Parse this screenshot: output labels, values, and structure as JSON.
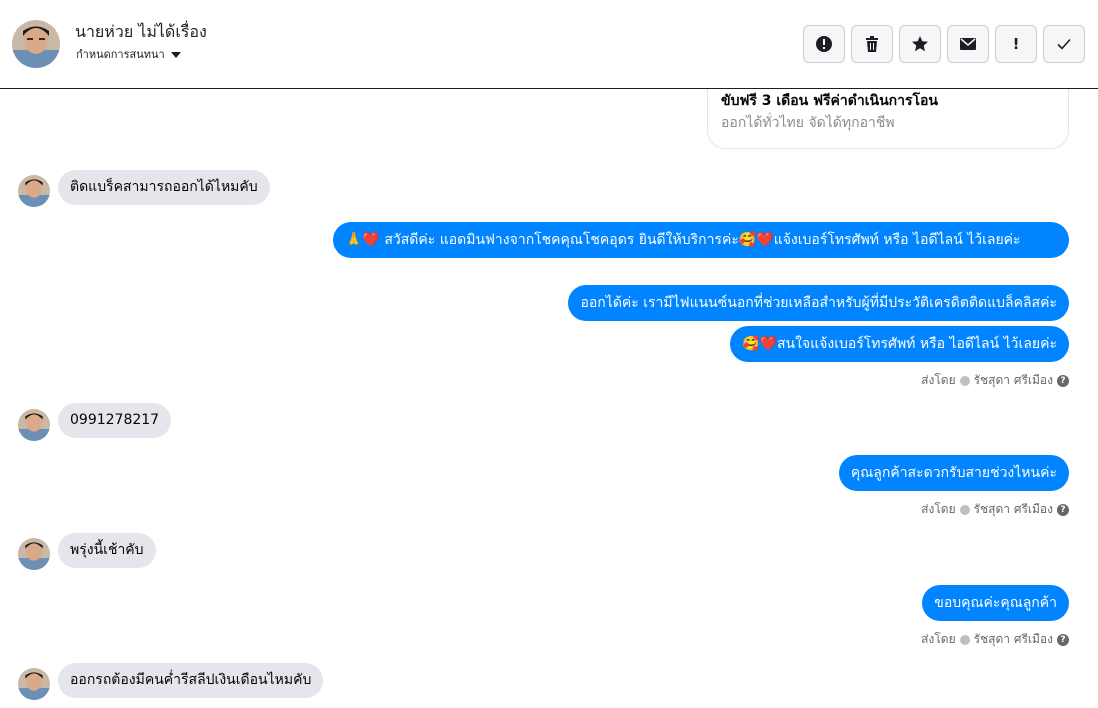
{
  "header": {
    "contact_name": "นายห่วย ไม่ได้เรื่อง",
    "subtitle": "กำหนดการสนทนา",
    "actions": [
      {
        "name": "report-button",
        "icon": "alert-circle-icon"
      },
      {
        "name": "delete-button",
        "icon": "trash-icon"
      },
      {
        "name": "star-button",
        "icon": "star-icon"
      },
      {
        "name": "mark-unread-button",
        "icon": "envelope-icon"
      },
      {
        "name": "flag-button",
        "icon": "exclamation-icon"
      },
      {
        "name": "done-button",
        "icon": "checkmark-icon"
      }
    ],
    "flag_label": "!"
  },
  "card": {
    "title": "ขับฟรี 3 เดือน ฟรีค่าดำเนินการโอน",
    "subtitle": "ออกได้ทั่วไทย จัดได้ทุกอาชีพ"
  },
  "messages": {
    "in1": "ติดแบร็คสามารถออกได้ไหมคับ",
    "out1": "🙏❤️ สวัสดีค่ะ แอดมินฟางจากโชคคุณโชคอุดร ยินดีให้บริการค่ะ🥰❤️แจ้งเบอร์โทรศัพท์ หรือ ไอดีไลน์  ไว้เลยค่ะ",
    "out2": "ออกได้ค่ะ เรามีไฟแนนซ์นอกที่ช่วยเหลือสำหรับผู้ที่มีประวัติเครดิตติดแบล็คลิสค่ะ",
    "out3": "🥰❤️สนใจแจ้งเบอร์โทรศัพท์ หรือ ไอดีไลน์  ไว้เลยค่ะ",
    "in2": "0991278217",
    "out4": "คุณลูกค้าสะดวกรับสายช่วงไหนค่ะ",
    "in3": "พรุ่งนี้เช้าคับ",
    "out5": "ขอบคุณค่ะคุณลูกค้า",
    "in4": "ออกรถต้องมีคนค่ำรีสลีปเงินเดือนไหมคับ"
  },
  "sent_by": {
    "prefix": "ส่งโดย",
    "agent": "รัชสุดา ศรีเมือง",
    "help": "?"
  },
  "colors": {
    "outgoing": "#0084ff",
    "incoming": "#e4e6eb",
    "meta_text": "#65676b"
  }
}
